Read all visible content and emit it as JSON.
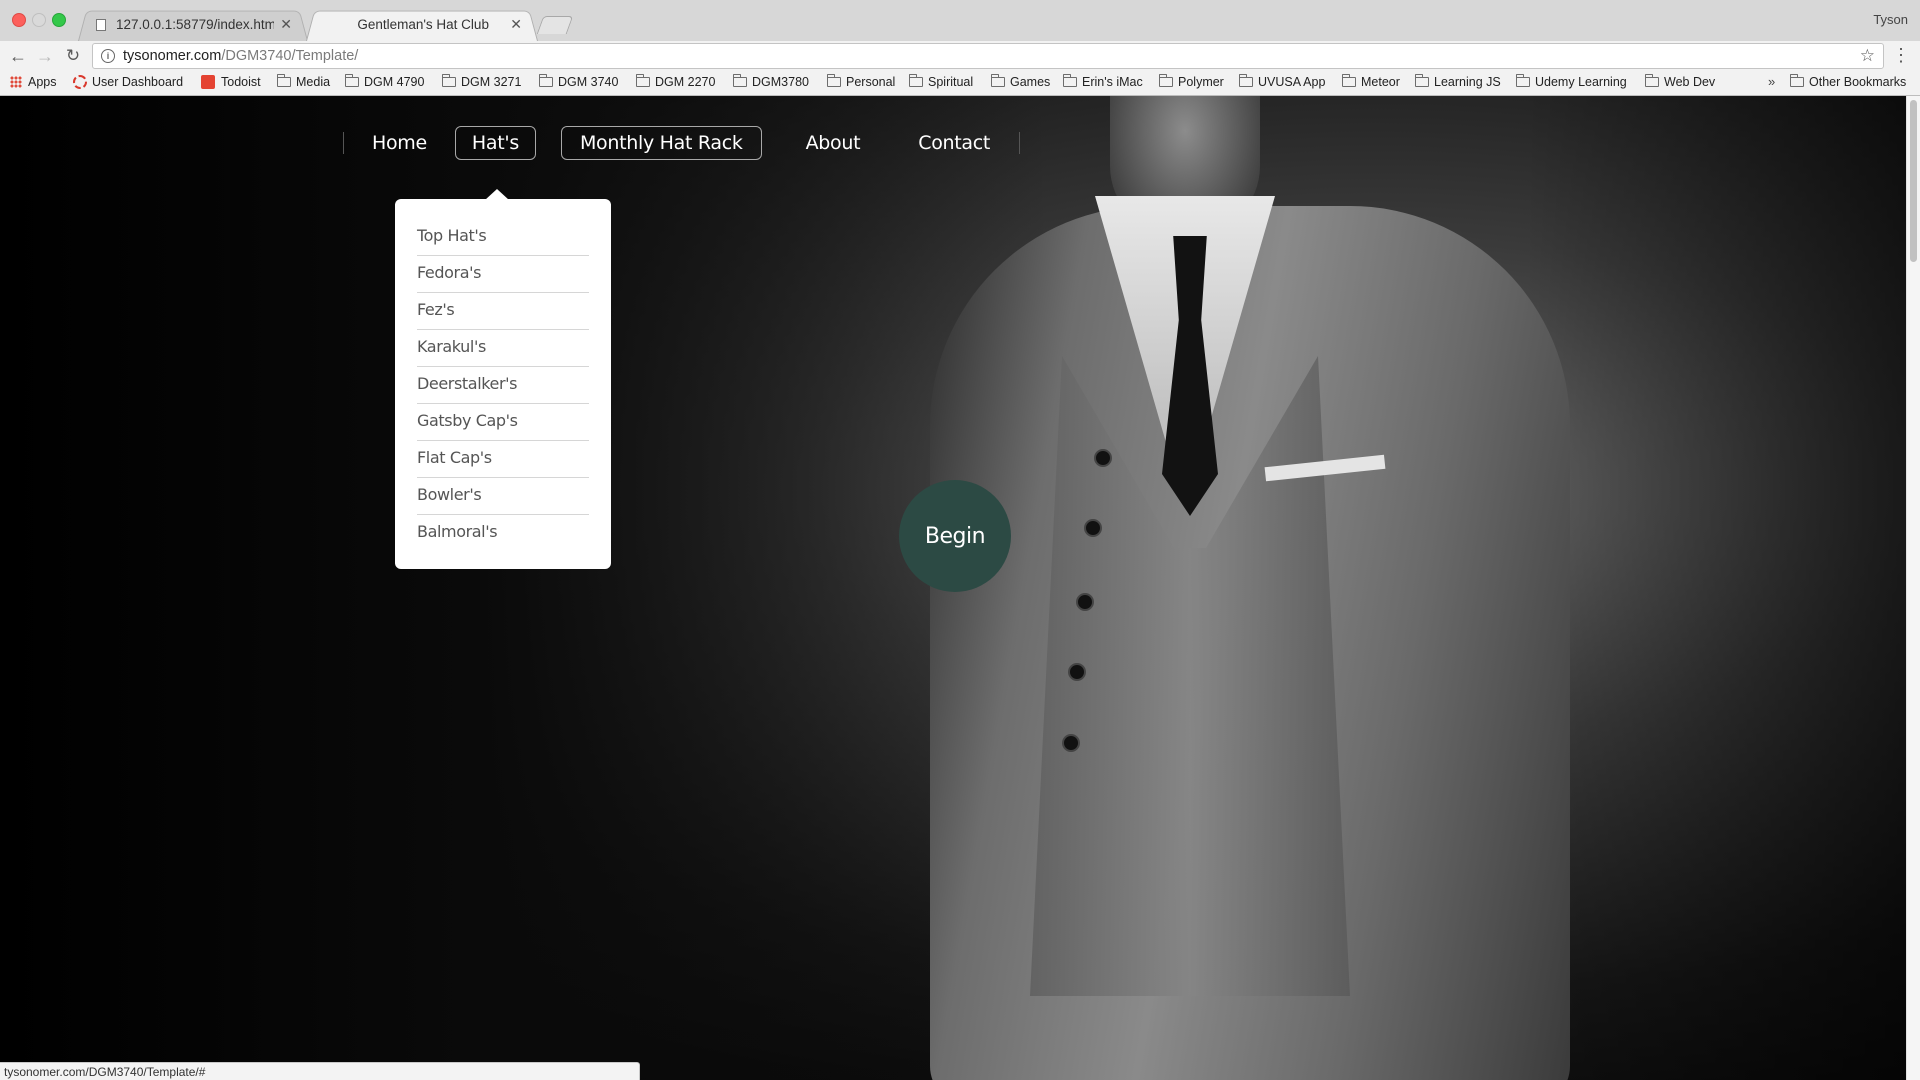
{
  "browser": {
    "tabs": [
      {
        "title": "127.0.0.1:58779/index.html",
        "active": false
      },
      {
        "title": "Gentleman's Hat Club",
        "active": true
      }
    ],
    "profile_name": "Tyson",
    "url": {
      "host": "tysonomer.com",
      "path": "/DGM3740/Template/"
    },
    "bookmarks": [
      {
        "label": "Apps",
        "icon": "apps-grid-icon"
      },
      {
        "label": "User Dashboard",
        "icon": "dashboard-icon"
      },
      {
        "label": "Todoist",
        "icon": "todoist-icon"
      },
      {
        "label": "Media",
        "icon": "folder-icon"
      },
      {
        "label": "DGM 4790",
        "icon": "folder-icon"
      },
      {
        "label": "DGM 3271",
        "icon": "folder-icon"
      },
      {
        "label": "DGM 3740",
        "icon": "folder-icon"
      },
      {
        "label": "DGM 2270",
        "icon": "folder-icon"
      },
      {
        "label": "DGM3780",
        "icon": "folder-icon"
      },
      {
        "label": "Personal",
        "icon": "folder-icon"
      },
      {
        "label": "Spiritual",
        "icon": "folder-icon"
      },
      {
        "label": "Games",
        "icon": "folder-icon"
      },
      {
        "label": "Erin's iMac",
        "icon": "folder-icon"
      },
      {
        "label": "Polymer",
        "icon": "folder-icon"
      },
      {
        "label": "UVUSA App",
        "icon": "folder-icon"
      },
      {
        "label": "Meteor",
        "icon": "folder-icon"
      },
      {
        "label": "Learning JS",
        "icon": "folder-icon"
      },
      {
        "label": "Udemy Learning",
        "icon": "folder-icon"
      },
      {
        "label": "Web Dev",
        "icon": "folder-icon"
      }
    ],
    "bookmarks_overflow": "»",
    "other_bookmarks": "Other Bookmarks",
    "status_url": "tysonomer.com/DGM3740/Template/#"
  },
  "site": {
    "nav": {
      "home": "Home",
      "hats": "Hat's",
      "rack": "Monthly Hat Rack",
      "about": "About",
      "contact": "Contact"
    },
    "hats_menu": [
      "Top Hat's",
      "Fedora's",
      "Fez's",
      "Karakul's",
      "Deerstalker's",
      "Gatsby Cap's",
      "Flat Cap's",
      "Bowler's",
      "Balmoral's"
    ],
    "begin_label": "Begin",
    "colors": {
      "begin_button": "#2c4a44",
      "dropdown_bg": "#ffffff",
      "nav_text": "#ffffff"
    }
  }
}
